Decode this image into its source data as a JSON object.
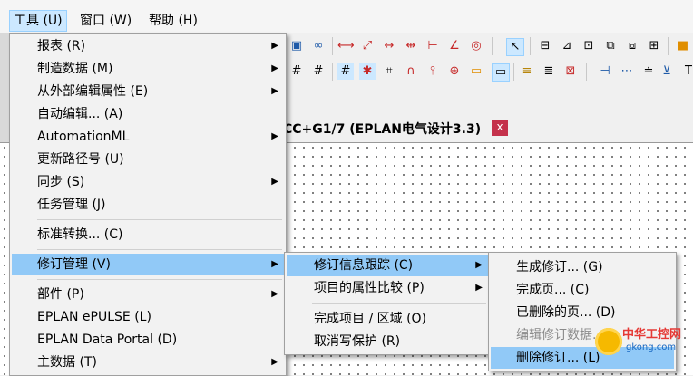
{
  "menubar": {
    "items": [
      {
        "label": "工具 (U)"
      },
      {
        "label": "窗口 (W)"
      },
      {
        "label": "帮助 (H)"
      }
    ]
  },
  "document_tab": {
    "title": "CC+G1/7 (EPLAN电气设计3.3)",
    "close": "x"
  },
  "tools_menu": {
    "items": [
      {
        "label": "报表 (R)"
      },
      {
        "label": "制造数据 (M)"
      },
      {
        "label": "从外部编辑属性 (E)"
      },
      {
        "label": "自动编辑... (A)"
      },
      {
        "label": "AutomationML"
      },
      {
        "label": "更新路径号 (U)"
      },
      {
        "label": "同步 (S)"
      },
      {
        "label": "任务管理 (J)"
      },
      {
        "label": "标准转换... (C)"
      },
      {
        "label": "修订管理 (V)"
      },
      {
        "label": "部件 (P)"
      },
      {
        "label": "EPLAN ePULSE (L)"
      },
      {
        "label": "EPLAN Data Portal (D)"
      },
      {
        "label": "主数据 (T)"
      }
    ]
  },
  "revision_menu": {
    "items": [
      {
        "label": "修订信息跟踪 (C)"
      },
      {
        "label": "项目的属性比较 (P)"
      },
      {
        "label": "完成项目 / 区域 (O)"
      },
      {
        "label": "取消写保护 (R)"
      }
    ]
  },
  "tracking_menu": {
    "items": [
      {
        "label": "生成修订... (G)"
      },
      {
        "label": "完成页... (C)"
      },
      {
        "label": "已删除的页... (D)"
      },
      {
        "label": "编辑修订数据..."
      },
      {
        "label": "删除修订... (L)"
      }
    ]
  },
  "watermark": {
    "text": "中华工控网",
    "url": "gkong.com"
  },
  "colors": {
    "highlight": "#91c9f7",
    "menubar_active": "#cce8ff",
    "close_button": "#c4314b"
  }
}
